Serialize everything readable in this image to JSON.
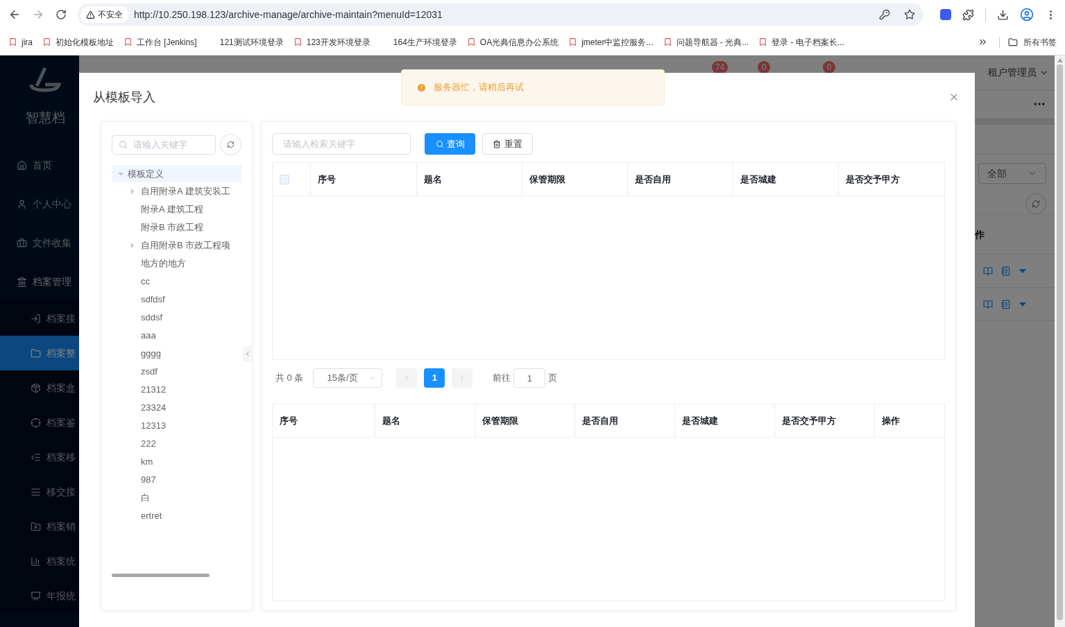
{
  "browser": {
    "security_label": "不安全",
    "url": "http://10.250.198.123/archive-manage/archive-maintain?menuId=12031",
    "bookmarks": [
      {
        "label": "jira",
        "kind": "icon"
      },
      {
        "label": "初始化模板地址",
        "kind": "icon"
      },
      {
        "label": "工作台 [Jenkins]",
        "kind": "icon"
      },
      {
        "label": "121测试环境登录",
        "kind": "blank"
      },
      {
        "label": "123开发环境登录",
        "kind": "icon"
      },
      {
        "label": "164生产环境登录",
        "kind": "blank"
      },
      {
        "label": "OA光典信息办公系统",
        "kind": "icon"
      },
      {
        "label": "jmeter中监控服务...",
        "kind": "icon"
      },
      {
        "label": "问题导航器 - 光典...",
        "kind": "icon"
      },
      {
        "label": "登录 - 电子档案长...",
        "kind": "icon"
      }
    ],
    "all_bookmarks": "所有书签"
  },
  "app": {
    "brand": "智慧档",
    "sidebar": [
      {
        "label": "首页",
        "selected": false
      },
      {
        "label": "个人中心",
        "selected": false
      },
      {
        "label": "文件收集",
        "selected": false
      },
      {
        "label": "档案管理",
        "selected": false,
        "expanded": true,
        "children": [
          {
            "label": "档案接",
            "selected": false
          },
          {
            "label": "档案整",
            "selected": true
          },
          {
            "label": "档案盒",
            "selected": false
          },
          {
            "label": "档案鉴",
            "selected": false
          },
          {
            "label": "档案移",
            "selected": false
          },
          {
            "label": "移交接",
            "selected": false
          },
          {
            "label": "档案销",
            "selected": false
          },
          {
            "label": "档案统",
            "selected": false
          },
          {
            "label": "年报统",
            "selected": false
          }
        ]
      }
    ],
    "badges": [
      "74",
      "0",
      "0"
    ],
    "user": "租户管理员",
    "filter": "全部",
    "column_header": "作",
    "rows": [
      {
        "kind": "actions"
      },
      {
        "kind": "actions"
      }
    ]
  },
  "toast": {
    "kind": "warning",
    "message": "服务器忙，请稍后再试"
  },
  "dialog": {
    "title": "从模板导入",
    "tree": {
      "placeholder": "请输入关键字",
      "nodes": [
        {
          "label": "模板定义",
          "selected": true,
          "expanded": true,
          "children": [
            {
              "label": "自用附录A 建筑安装工",
              "kind": "folder",
              "selected": false
            },
            {
              "label": "附录A 建筑工程",
              "kind": "leaf",
              "selected": false
            },
            {
              "label": "附录B 市政工程",
              "kind": "leaf",
              "selected": false
            },
            {
              "label": "自用附录B 市政工程项",
              "kind": "folder",
              "selected": false
            },
            {
              "label": "地方的地方",
              "kind": "leaf",
              "selected": false
            },
            {
              "label": "cc",
              "kind": "leaf",
              "selected": false
            },
            {
              "label": "sdfdsf",
              "kind": "leaf",
              "selected": false
            },
            {
              "label": "sddsf",
              "kind": "leaf",
              "selected": false
            },
            {
              "label": "aaa",
              "kind": "leaf",
              "selected": false
            },
            {
              "label": "gggg",
              "kind": "leaf",
              "selected": false
            },
            {
              "label": "zsdf",
              "kind": "leaf",
              "selected": false
            },
            {
              "label": "21312",
              "kind": "leaf",
              "selected": false
            },
            {
              "label": "23324",
              "kind": "leaf",
              "selected": false
            },
            {
              "label": "12313",
              "kind": "leaf",
              "selected": false
            },
            {
              "label": "222",
              "kind": "leaf",
              "selected": false
            },
            {
              "label": "km",
              "kind": "leaf",
              "selected": false
            },
            {
              "label": "987",
              "kind": "leaf",
              "selected": false
            },
            {
              "label": "白",
              "kind": "leaf",
              "selected": false
            },
            {
              "label": "ertret",
              "kind": "leaf",
              "selected": false
            }
          ]
        }
      ]
    },
    "search": {
      "placeholder": "请输入检索关键字"
    },
    "query_button": "查询",
    "reset_button": "重置",
    "source_table": {
      "select_all": {
        "checked": false
      },
      "columns": [
        "序号",
        "题名",
        "保管期限",
        "是否自用",
        "是否城建",
        "是否交予甲方"
      ]
    },
    "pagination": {
      "total": "共 0 条",
      "page_size": "15条/页",
      "prev": {
        "disabled": true
      },
      "pages": [
        {
          "label": "1",
          "selected": true
        }
      ],
      "next": {
        "disabled": true
      },
      "goto_label": "前往",
      "goto_value": "1",
      "goto_suffix": "页"
    },
    "selected_table": {
      "columns": [
        "序号",
        "题名",
        "保管期限",
        "是否自用",
        "是否城建",
        "是否交予甲方",
        "操作"
      ]
    }
  }
}
